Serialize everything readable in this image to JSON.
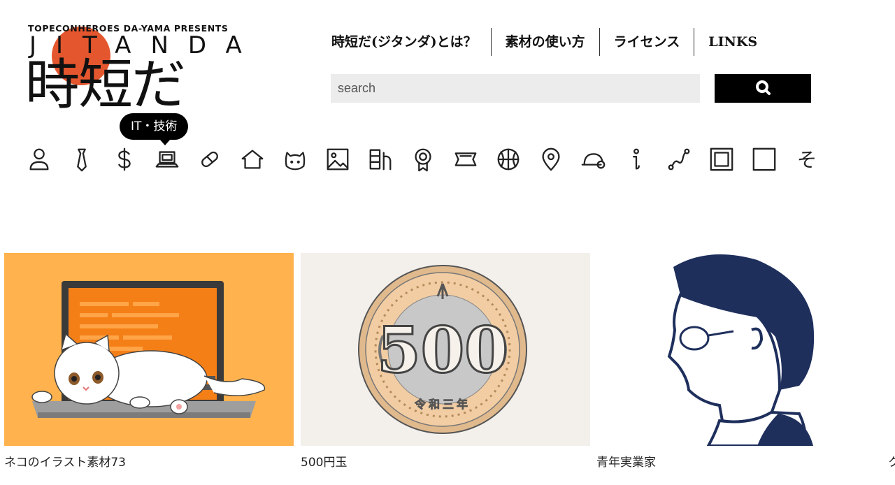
{
  "logo": {
    "tagline": "TOPECONHEROES DA-YAMA PRESENTS",
    "wordmark": "JITANDA",
    "kana": "時短だ",
    "sun_color": "#e4572e"
  },
  "nav": {
    "items": [
      {
        "label": "時短だ(ジタンダ)とは？"
      },
      {
        "label": "素材の使い方"
      },
      {
        "label": "ライセンス"
      },
      {
        "label": "LINKS"
      }
    ]
  },
  "search": {
    "placeholder": "search",
    "value": "",
    "button_icon": "search-icon"
  },
  "tooltip": {
    "label": "IT・技術"
  },
  "categories": [
    {
      "icon": "person-icon"
    },
    {
      "icon": "necktie-icon"
    },
    {
      "icon": "dollar-icon"
    },
    {
      "icon": "laptop-icon",
      "active": true
    },
    {
      "icon": "capsule-icon"
    },
    {
      "icon": "house-icon"
    },
    {
      "icon": "cat-icon"
    },
    {
      "icon": "picture-icon"
    },
    {
      "icon": "calendar-icon"
    },
    {
      "icon": "medal-icon"
    },
    {
      "icon": "sign-icon"
    },
    {
      "icon": "basketball-icon"
    },
    {
      "icon": "map-pin-icon"
    },
    {
      "icon": "helmet-icon"
    },
    {
      "icon": "info-icon"
    },
    {
      "icon": "route-icon"
    },
    {
      "icon": "double-square-icon"
    },
    {
      "icon": "square-icon"
    },
    {
      "icon": "so-kana-icon",
      "glyph": "そ"
    }
  ],
  "cards": [
    {
      "caption": "ネコのイラスト素材73",
      "bg": "#ffb24d"
    },
    {
      "caption": "500円玉",
      "bg": "#f3efeb",
      "coin_value": "500",
      "coin_era": "令和三年"
    },
    {
      "caption": "青年実業家",
      "bg": "#ffffff"
    },
    {
      "caption": "ク"
    }
  ],
  "colors": {
    "accent": "#e4572e",
    "search_bg": "#ececec",
    "button_bg": "#000000",
    "navy": "#1e2f5c"
  }
}
